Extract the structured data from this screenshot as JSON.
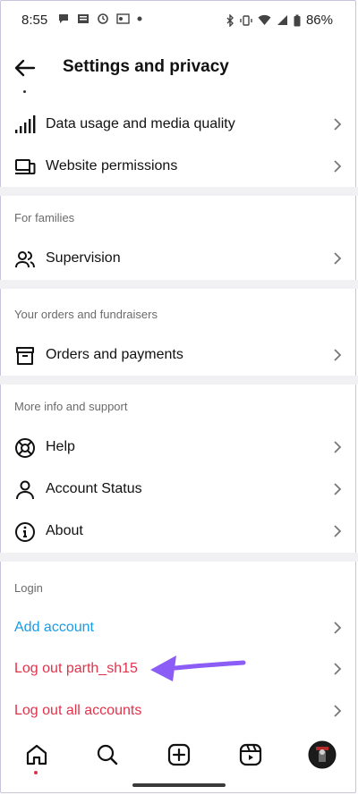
{
  "status_bar": {
    "time": "8:55",
    "battery": "86%"
  },
  "header": {
    "title": "Settings and privacy",
    "back_icon": "arrow-left-icon"
  },
  "sections": {
    "media": {
      "items": [
        {
          "label": "Data usage and media quality",
          "icon": "signal-bars-icon"
        },
        {
          "label": "Website permissions",
          "icon": "devices-icon"
        }
      ]
    },
    "families": {
      "title": "For families",
      "items": [
        {
          "label": "Supervision",
          "icon": "people-icon"
        }
      ]
    },
    "orders": {
      "title": "Your orders and fundraisers",
      "items": [
        {
          "label": "Orders and payments",
          "icon": "box-icon"
        }
      ]
    },
    "support": {
      "title": "More info and support",
      "items": [
        {
          "label": "Help",
          "icon": "lifebuoy-icon"
        },
        {
          "label": "Account Status",
          "icon": "person-icon"
        },
        {
          "label": "About",
          "icon": "info-icon"
        }
      ]
    },
    "login": {
      "title": "Login",
      "items": [
        {
          "label": "Add account"
        },
        {
          "label": "Log out parth_sh15"
        },
        {
          "label": "Log out all accounts"
        }
      ]
    }
  },
  "colors": {
    "link_blue": "#1a9be6",
    "danger_red": "#e0334c",
    "annotation_purple": "#8b5cf6",
    "section_divider": "#f1f1f3"
  },
  "tab_bar": {
    "items": [
      "home-icon",
      "search-icon",
      "create-icon",
      "reels-icon",
      "profile-avatar"
    ]
  }
}
